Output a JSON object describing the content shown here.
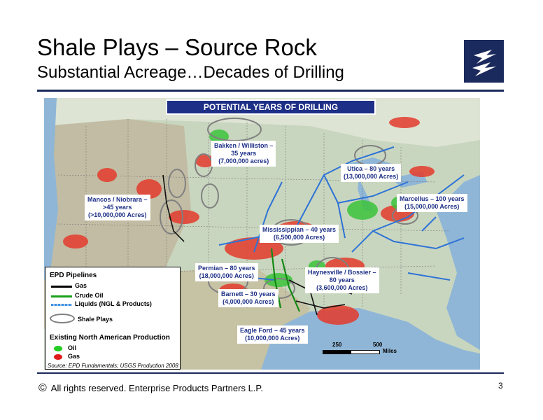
{
  "header": {
    "title": "Shale Plays – Source Rock",
    "subtitle": "Substantial Acreage…Decades of Drilling"
  },
  "map": {
    "banner": "POTENTIAL YEARS OF DRILLING",
    "plays": [
      {
        "lines": [
          "Bakken / Williston –",
          "35 years",
          "(7,000,000 acres)"
        ]
      },
      {
        "lines": [
          "Utica – 80 years",
          "(13,000,000 Acres)"
        ]
      },
      {
        "lines": [
          "Marcellus – 100 years",
          "(15,000,000 Acres)"
        ]
      },
      {
        "lines": [
          "Mancos / Niobrara –",
          ">45 years",
          "(>10,000,000 Acres)"
        ]
      },
      {
        "lines": [
          "Mississippian – 40 years",
          "(6,500,000 Acres)"
        ]
      },
      {
        "lines": [
          "Permian – 80 years",
          "(18,000,000 Acres)"
        ]
      },
      {
        "lines": [
          "Haynesville / Bossier –",
          "80 years",
          "(3,600,000 Acres)"
        ]
      },
      {
        "lines": [
          "Barnett – 30 years",
          "(4,000,000 Acres)"
        ]
      },
      {
        "lines": [
          "Eagle Ford – 45 years",
          "(10,000,000 Acres)"
        ]
      }
    ],
    "scale": {
      "tick_250": "250",
      "tick_500": "500",
      "unit": "Miles"
    }
  },
  "legend": {
    "pipelines_title": "EPD Pipelines",
    "gas": "Gas",
    "crude": "Crude Oil",
    "liquids": "Liquids (NGL & Products)",
    "shale": "Shale Plays",
    "production_title": "Existing North American Production",
    "oil": "Oil",
    "gas2": "Gas",
    "source": "Source:  EPD Fundamentals; USGS Production 2008",
    "colors": {
      "gas": "#000000",
      "crude": "#1aa01a",
      "liquids": "#3f8fe0",
      "oil_dot": "#22cc22",
      "gas_dot": "#e01b1b"
    }
  },
  "footer": {
    "copyright_symbol": "©",
    "text": "All rights reserved. Enterprise Products Partners L.P.",
    "page": "3"
  }
}
